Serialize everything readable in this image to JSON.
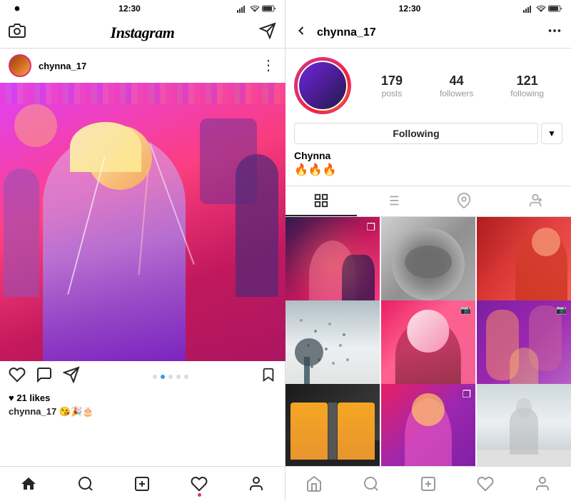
{
  "app": {
    "name": "Instagram"
  },
  "left": {
    "status_bar": {
      "time": "12:30"
    },
    "top_nav": {
      "camera_icon": "📷",
      "logo": "Instagram",
      "send_icon": "✈"
    },
    "post": {
      "username": "chynna_17",
      "more_icon": "⋮",
      "likes": "♥ 21 likes",
      "caption_user": "chynna_17",
      "caption_text": " 😘🎉🎂",
      "dot_count": 5,
      "active_dot": 2
    },
    "actions": {
      "like_icon": "♡",
      "comment_icon": "💬",
      "share_icon": "✈",
      "bookmark_icon": "🔖"
    },
    "bottom_nav": {
      "home": "⌂",
      "search": "🔍",
      "add": "⊕",
      "heart": "♡",
      "profile": "👤"
    }
  },
  "right": {
    "status_bar": {
      "time": "12:30"
    },
    "top_nav": {
      "back_icon": "←",
      "username": "chynna_17",
      "more_icon": "⋮"
    },
    "profile": {
      "stats": {
        "posts_count": "179",
        "posts_label": "posts",
        "followers_count": "44",
        "followers_label": "followers",
        "following_count": "121",
        "following_label": "following"
      },
      "following_button": "Following",
      "dropdown_icon": "▼",
      "bio_name": "Chynna",
      "bio_emoji": "🔥🔥🔥"
    },
    "grid": {
      "items": [
        {
          "id": 1,
          "type": "multi"
        },
        {
          "id": 2,
          "type": "single"
        },
        {
          "id": 3,
          "type": "single"
        },
        {
          "id": 4,
          "type": "single"
        },
        {
          "id": 5,
          "type": "video"
        },
        {
          "id": 6,
          "type": "video"
        },
        {
          "id": 7,
          "type": "single"
        },
        {
          "id": 8,
          "type": "multi"
        },
        {
          "id": 9,
          "type": "single"
        }
      ]
    },
    "bottom_nav": {
      "home": "⌂",
      "search": "🔍",
      "add": "⊕",
      "heart": "♡",
      "profile": "👤"
    }
  }
}
